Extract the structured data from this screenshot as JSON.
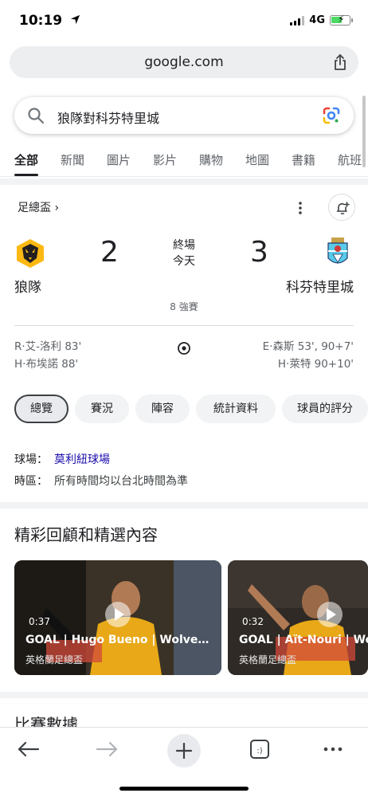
{
  "status_bar": {
    "time": "10:19",
    "network": "4G"
  },
  "browser": {
    "url": "google.com"
  },
  "search": {
    "query": "狼隊對科芬特里城"
  },
  "tabs": [
    {
      "label": "全部",
      "active": true
    },
    {
      "label": "新聞"
    },
    {
      "label": "圖片"
    },
    {
      "label": "影片"
    },
    {
      "label": "購物"
    },
    {
      "label": "地圖"
    },
    {
      "label": "書籍"
    },
    {
      "label": "航班"
    }
  ],
  "match": {
    "league_label": "足總盃",
    "league_chevron": "›",
    "home": {
      "name": "狼隊",
      "score": "2"
    },
    "away": {
      "name": "科芬特里城",
      "score": "3"
    },
    "status": "終場",
    "date": "今天",
    "round": "8 強賽",
    "home_scorers": [
      "R·艾-洛利 83'",
      "H·布埃諾 88'"
    ],
    "away_scorers": [
      "E·森斯 53', 90+7'",
      "H·萊特 90+10'"
    ]
  },
  "chips": [
    "總覽",
    "賽況",
    "陣容",
    "統計資料",
    "球員的評分"
  ],
  "info": {
    "venue_label": "球場：",
    "venue_value": "莫利紐球場",
    "timezone_label": "時區：",
    "timezone_value": "所有時間均以台北時間為準"
  },
  "highlights": {
    "title": "精彩回顧和精選內容",
    "videos": [
      {
        "duration": "0:37",
        "title": "GOAL | Hugo Bueno | Wolves ...",
        "source": "英格蘭足總盃"
      },
      {
        "duration": "0:32",
        "title": "GOAL | Aït-Nouri | Wolves",
        "source": "英格蘭足總盃"
      }
    ]
  },
  "next_section_title": "比賽數據",
  "colors": {
    "link": "#1a0dab",
    "wolves_gold": "#FDB913",
    "coventry_blue": "#59CBE8"
  },
  "icons": [
    "location-arrow-icon",
    "share-icon",
    "search-icon",
    "google-lens-icon",
    "more-vert-icon",
    "bell-add-icon",
    "soccer-ball-icon",
    "play-icon",
    "back-icon",
    "forward-icon",
    "plus-icon",
    "tabs-icon",
    "more-horiz-icon"
  ]
}
